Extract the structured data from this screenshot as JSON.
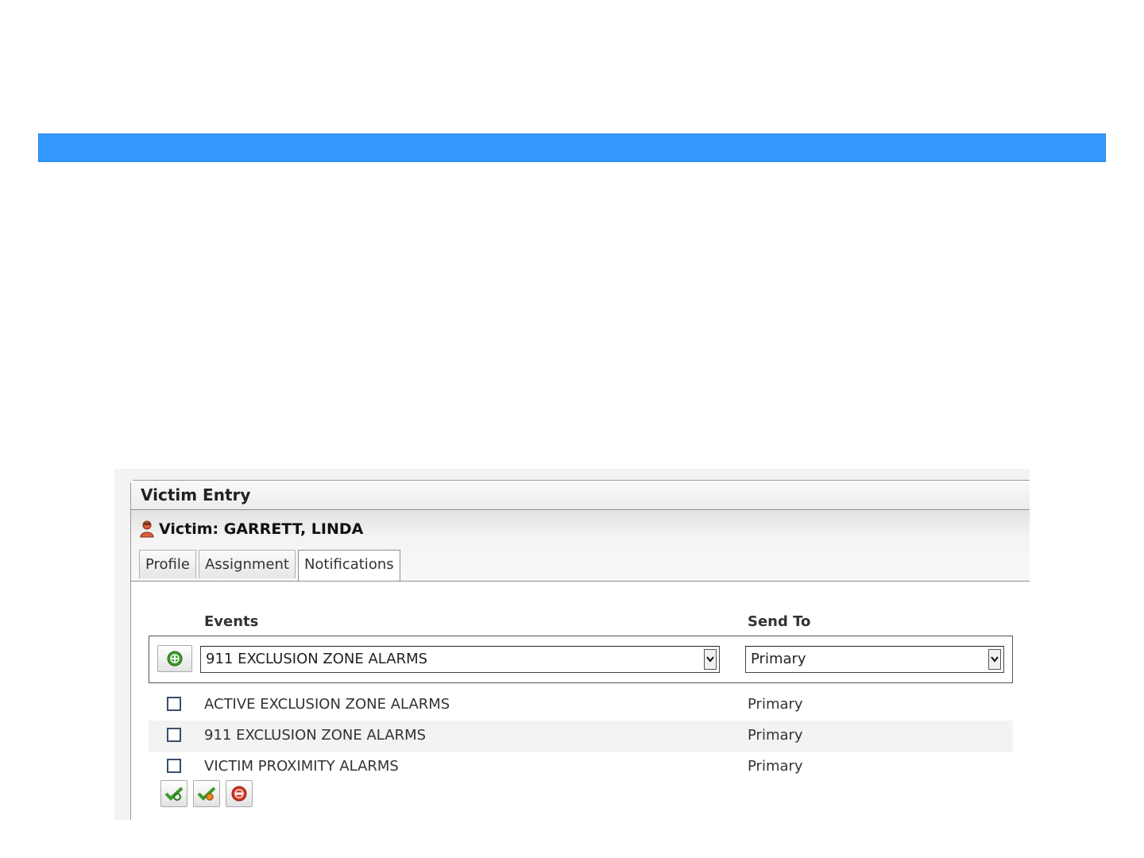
{
  "colors": {
    "banner": "#3399ff",
    "add_icon": "#3a9a2a",
    "remove_icon": "#d63a2a"
  },
  "panel": {
    "title": "Victim Entry"
  },
  "victim": {
    "label": "Victim: GARRETT, LINDA",
    "icon": "person-icon"
  },
  "tabs": [
    {
      "label": "Profile",
      "active": false
    },
    {
      "label": "Assignment",
      "active": false
    },
    {
      "label": "Notifications",
      "active": true
    }
  ],
  "table": {
    "headers": {
      "events": "Events",
      "send_to": "Send To"
    },
    "new_entry": {
      "event_value": "911 EXCLUSION ZONE ALARMS",
      "send_to_value": "Primary",
      "add_icon": "add-icon"
    },
    "rows": [
      {
        "event": "ACTIVE EXCLUSION ZONE ALARMS",
        "send_to": "Primary",
        "checked": false
      },
      {
        "event": "911 EXCLUSION ZONE ALARMS",
        "send_to": "Primary",
        "checked": false
      },
      {
        "event": "VICTIM PROXIMITY ALARMS",
        "send_to": "Primary",
        "checked": false
      }
    ]
  },
  "actions": [
    {
      "icon": "save-check-icon"
    },
    {
      "icon": "save-check-alt-icon"
    },
    {
      "icon": "remove-icon"
    }
  ]
}
